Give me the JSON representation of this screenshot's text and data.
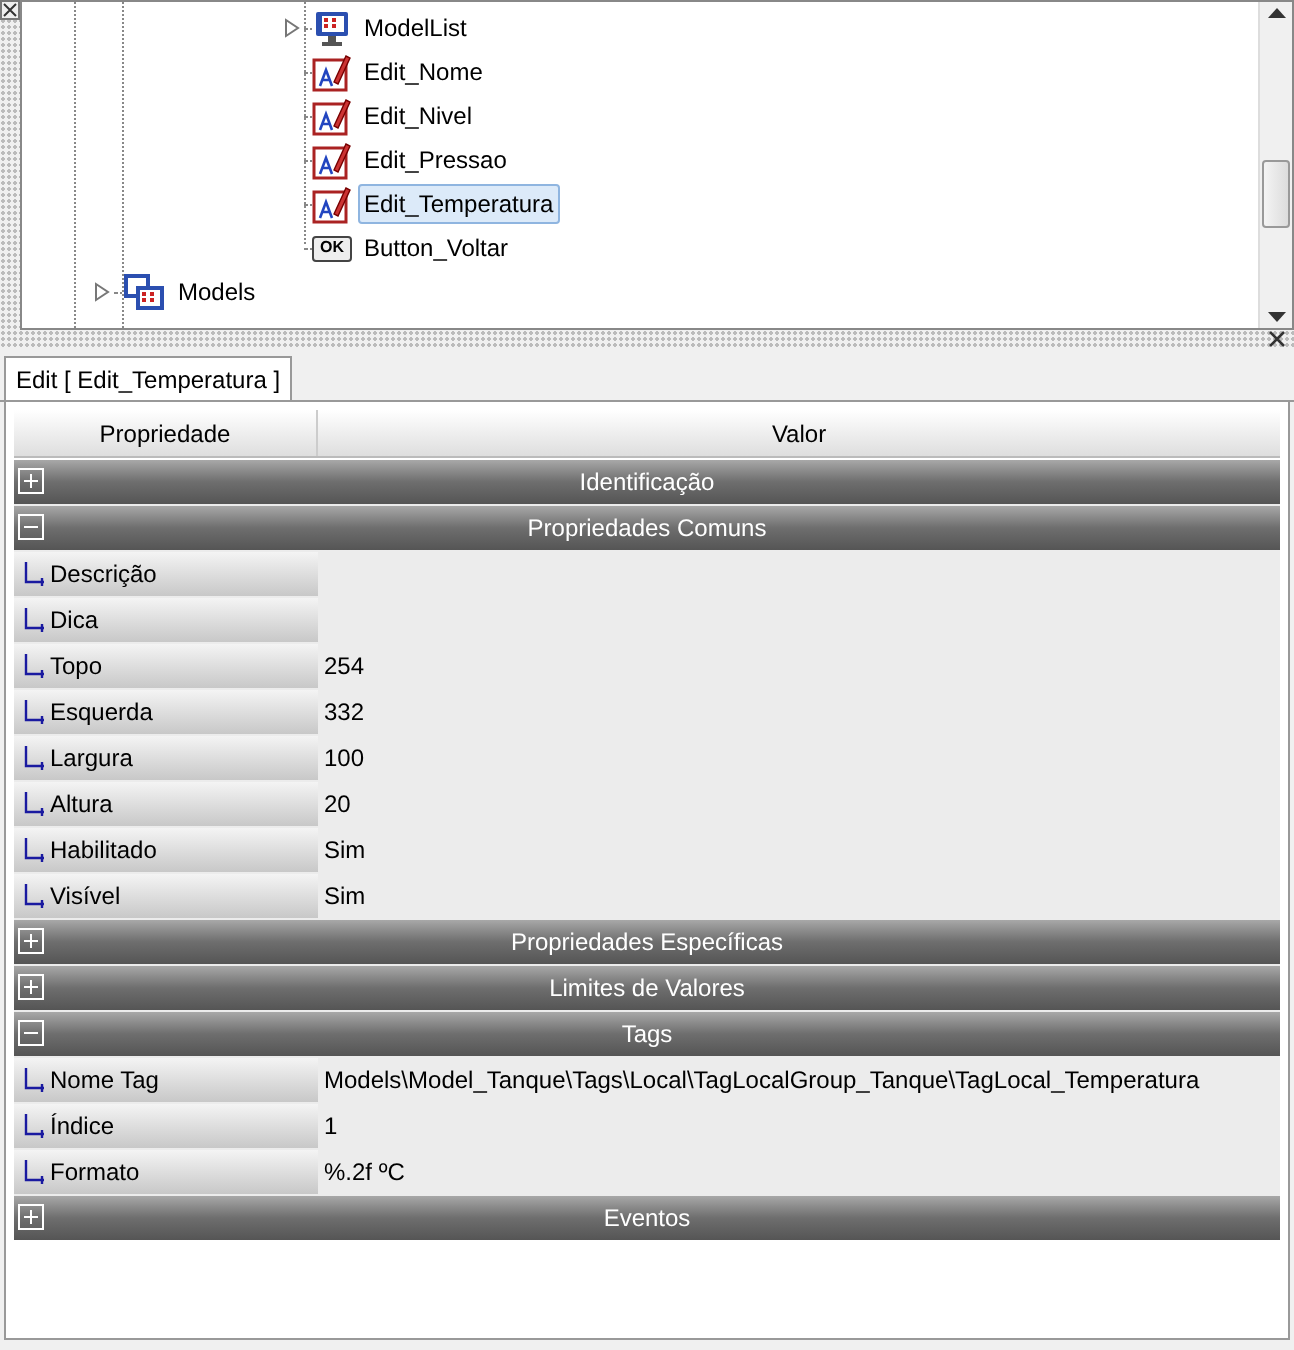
{
  "tree": {
    "items": [
      {
        "children": [
          {
            "label": "ModelList",
            "kind": "list",
            "expanded": false,
            "selected": false
          },
          {
            "label": "Edit_Nome",
            "kind": "edit",
            "selected": false
          },
          {
            "label": "Edit_Nivel",
            "kind": "edit",
            "selected": false
          },
          {
            "label": "Edit_Pressao",
            "kind": "edit",
            "selected": false
          },
          {
            "label": "Edit_Temperatura",
            "kind": "edit",
            "selected": true
          },
          {
            "label": "Button_Voltar",
            "kind": "button",
            "button_text": "OK",
            "selected": false
          }
        ]
      },
      {
        "label": "Models",
        "kind": "models",
        "expanded": false,
        "selected": false
      }
    ]
  },
  "tab": {
    "label": "Edit [ Edit_Temperatura ]",
    "selected": true
  },
  "grid": {
    "columns": [
      "Propriedade",
      "Valor"
    ],
    "sections": [
      {
        "title": "Identificação",
        "expanded": false
      },
      {
        "title": "Propriedades Comuns",
        "expanded": true,
        "rows": [
          {
            "name": "Descrição",
            "value": ""
          },
          {
            "name": "Dica",
            "value": ""
          },
          {
            "name": "Topo",
            "value": "254"
          },
          {
            "name": "Esquerda",
            "value": "332"
          },
          {
            "name": "Largura",
            "value": "100"
          },
          {
            "name": "Altura",
            "value": "20"
          },
          {
            "name": "Habilitado",
            "value": "Sim"
          },
          {
            "name": "Visível",
            "value": "Sim"
          }
        ]
      },
      {
        "title": "Propriedades Específicas",
        "expanded": false
      },
      {
        "title": "Limites de Valores",
        "expanded": false
      },
      {
        "title": "Tags",
        "expanded": true,
        "rows": [
          {
            "name": "Nome Tag",
            "value": "Models\\Model_Tanque\\Tags\\Local\\TagLocalGroup_Tanque\\TagLocal_Temperatura"
          },
          {
            "name": "Índice",
            "value": "1"
          },
          {
            "name": "Formato",
            "value": "%.2f  ºC"
          }
        ]
      },
      {
        "title": "Eventos",
        "expanded": false
      }
    ]
  }
}
